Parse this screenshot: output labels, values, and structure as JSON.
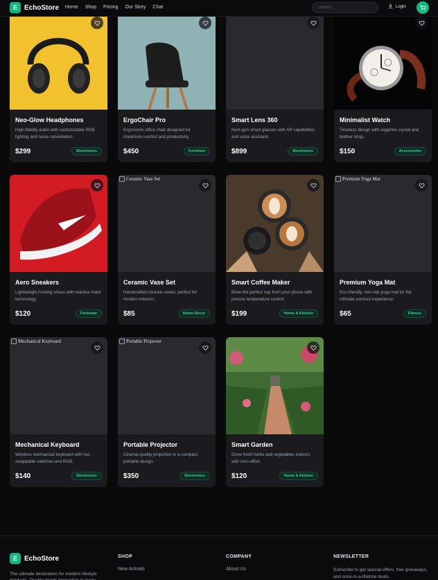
{
  "header": {
    "brand": "EchoStore",
    "brand_mark": "E",
    "nav": [
      "Home",
      "Shop",
      "Pricing",
      "Our Story",
      "Chat"
    ],
    "search_placeholder": "Search...",
    "login_label": "Login"
  },
  "products": [
    {
      "title": "Neo-Glow Headphones",
      "desc": "High-fidelity audio with customizable RGB lighting and noise cancellation.",
      "price": "$299",
      "category": "Electronics"
    },
    {
      "title": "ErgoChair Pro",
      "desc": "Ergonomic office chair designed for maximum comfort and productivity.",
      "price": "$450",
      "category": "Furniture"
    },
    {
      "title": "Smart Lens 360",
      "desc": "Next-gen smart glasses with AR capabilities and voice assistant.",
      "price": "$899",
      "category": "Electronics"
    },
    {
      "title": "Minimalist Watch",
      "desc": "Timeless design with sapphire crystal and leather strap.",
      "price": "$150",
      "category": "Accessories"
    },
    {
      "title": "Aero Sneakers",
      "desc": "Lightweight running shoes with reactive foam technology.",
      "price": "$120",
      "category": "Footwear"
    },
    {
      "title": "Ceramic Vase Set",
      "alt": "Ceramic Vase Set",
      "desc": "Handcrafted ceramic vases, perfect for modern interiors.",
      "price": "$85",
      "category": "Home Decor"
    },
    {
      "title": "Smart Coffee Maker",
      "desc": "Brew the perfect cup from your phone with precise temperature control.",
      "price": "$199",
      "category": "Home & Kitchen"
    },
    {
      "title": "Premium Yoga Mat",
      "alt": "Premium Yoga Mat",
      "desc": "Eco-friendly, non-slip yoga mat for the ultimate workout experience.",
      "price": "$65",
      "category": "Fitness"
    },
    {
      "title": "Mechanical Keyboard",
      "alt": "Mechanical Keyboard",
      "desc": "Wireless mechanical keyboard with hot-swappable switches and RGB.",
      "price": "$140",
      "category": "Electronics"
    },
    {
      "title": "Portable Projector",
      "alt": "Portable Projector",
      "desc": "Cinema-quality projection in a compact, portable design.",
      "price": "$350",
      "category": "Electronics"
    },
    {
      "title": "Smart Garden",
      "desc": "Grow fresh herbs and vegetables indoors with zero effort.",
      "price": "$120",
      "category": "Home & Kitchen"
    }
  ],
  "footer": {
    "brand": "EchoStore",
    "about": "The ultimate destination for modern lifestyle products. Quality meets innovation in every",
    "shop_heading": "SHOP",
    "shop_link": "New Arrivals",
    "company_heading": "COMPANY",
    "company_link": "About Us",
    "newsletter_heading": "NEWSLETTER",
    "newsletter_text": "Subscribe to get special offers, free giveaways, and once-in-a-lifetime deals."
  },
  "colors": {
    "accent": "#10b981",
    "background": "#0a0a0b",
    "card": "#1b1b1f"
  }
}
